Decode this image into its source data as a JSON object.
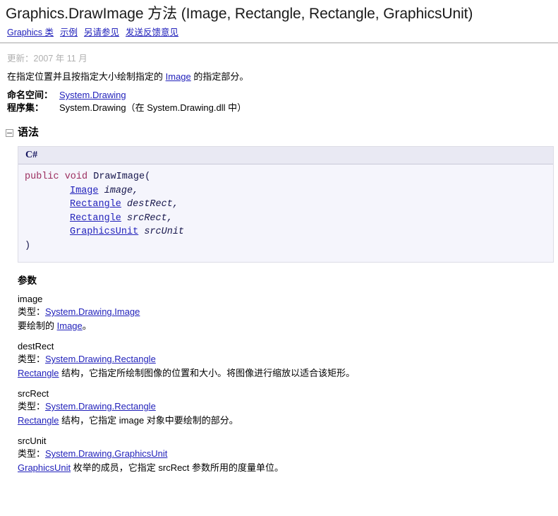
{
  "page": {
    "title": "Graphics.DrawImage 方法 (Image, Rectangle, Rectangle, GraphicsUnit)",
    "updated": "更新：2007 年 11 月",
    "summary_prefix": "在指定位置并且按指定大小绘制指定的 ",
    "summary_link": "Image",
    "summary_suffix": " 的指定部分。"
  },
  "header_links": [
    {
      "text": "Graphics",
      "suffix": " 类",
      "is_link": true
    },
    {
      "text": "示例",
      "suffix": "",
      "is_link": true
    },
    {
      "text": "另请参见",
      "suffix": "",
      "is_link": true
    },
    {
      "text": "发送反馈意见",
      "suffix": "",
      "is_link": true
    }
  ],
  "meta": {
    "namespace_label": "命名空间：",
    "namespace_value": "System.Drawing",
    "assembly_label": "程序集：",
    "assembly_value": "System.Drawing（在 System.Drawing.dll 中）"
  },
  "syntax": {
    "heading": "语法",
    "language": "C#",
    "lines": {
      "l1_kw": "public void",
      "l1_rest": " DrawImage(",
      "l2_type": "Image",
      "l2_param": " image,",
      "l3_type": "Rectangle",
      "l3_param": " destRect,",
      "l4_type": "Rectangle",
      "l4_param": " srcRect,",
      "l5_type": "GraphicsUnit",
      "l5_param": " srcUnit",
      "l6_close": ")"
    }
  },
  "parameters": {
    "heading": "参数",
    "type_label": "类型：",
    "items": [
      {
        "name": "image",
        "type": "System.Drawing.Image",
        "desc_link": "",
        "desc_pre": "要绘制的 ",
        "desc_inline_link": "Image",
        "desc_post": "。"
      },
      {
        "name": "destRect",
        "type": "System.Drawing.Rectangle",
        "desc_link": "Rectangle",
        "desc_pre": "",
        "desc_inline_link": "",
        "desc_post": " 结构，它指定所绘制图像的位置和大小。将图像进行缩放以适合该矩形。"
      },
      {
        "name": "srcRect",
        "type": "System.Drawing.Rectangle",
        "desc_link": "Rectangle",
        "desc_pre": "",
        "desc_inline_link": "",
        "desc_post": " 结构，它指定 image 对象中要绘制的部分。"
      },
      {
        "name": "srcUnit",
        "type": "System.Drawing.GraphicsUnit",
        "desc_link": "GraphicsUnit",
        "desc_pre": "",
        "desc_inline_link": "",
        "desc_post": " 枚举的成员，它指定 srcRect 参数所用的度量单位。"
      }
    ]
  },
  "colors": {
    "link": "#2222bb",
    "keyword": "#9b2d5e",
    "code_text": "#16164c",
    "code_bg": "#f5f5fc",
    "code_header_bg": "#e9e9f3",
    "muted": "#b0b0b0"
  }
}
